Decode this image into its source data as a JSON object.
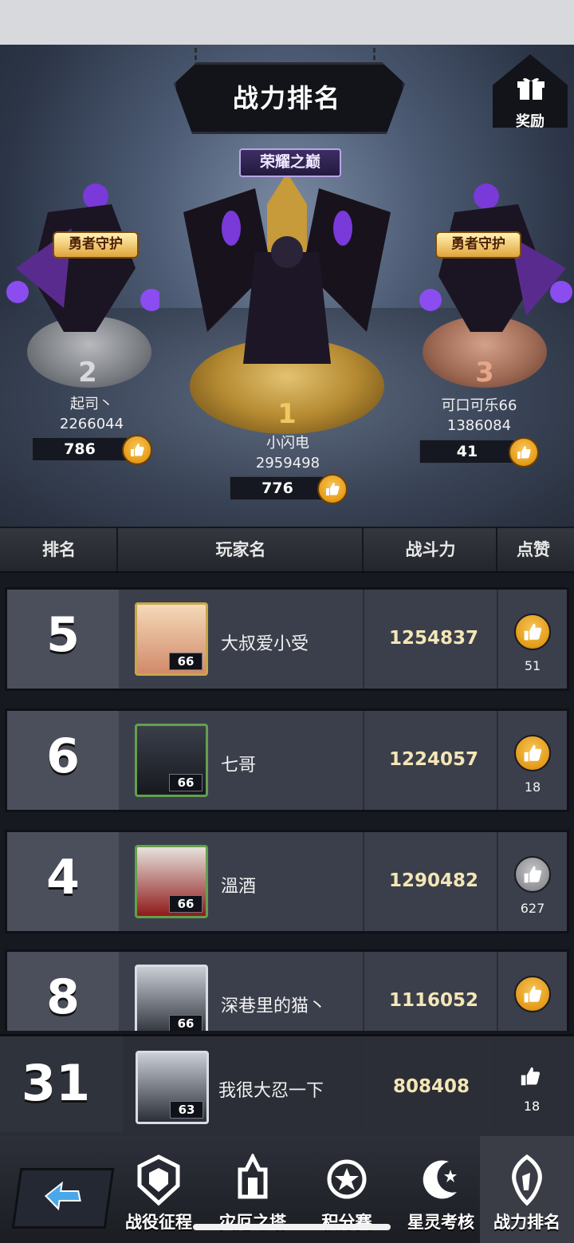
{
  "header": {
    "title": "战力排名",
    "reward_label": "奖励",
    "glory_label": "荣耀之巅",
    "guardian_label": "勇者守护"
  },
  "podium": [
    {
      "rank": "1",
      "name": "小闪电",
      "power": "2959498",
      "likes": "776"
    },
    {
      "rank": "2",
      "name": "起司丶",
      "power": "2266044",
      "likes": "786"
    },
    {
      "rank": "3",
      "name": "可口可乐66",
      "power": "1386084",
      "likes": "41"
    }
  ],
  "table": {
    "headers": [
      "排名",
      "玩家名",
      "战斗力",
      "点赞"
    ],
    "rows": [
      {
        "rank": "5",
        "name": "大叔爱小受",
        "power": "1254837",
        "likes": "51",
        "level": "66",
        "liked": false
      },
      {
        "rank": "6",
        "name": "七哥",
        "power": "1224057",
        "likes": "18",
        "level": "66",
        "liked": false
      },
      {
        "rank": "4",
        "name": "溫酒",
        "power": "1290482",
        "likes": "627",
        "level": "66",
        "liked": true
      },
      {
        "rank": "8",
        "name": "深巷里的猫丶",
        "power": "1116052",
        "likes": "",
        "level": "66",
        "liked": false
      }
    ]
  },
  "my_rank": {
    "rank": "31",
    "name": "我很大忍一下",
    "power": "808408",
    "likes": "18",
    "level": "63"
  },
  "nav": [
    {
      "label": "战役征程"
    },
    {
      "label": "灾厄之塔"
    },
    {
      "label": "积分赛"
    },
    {
      "label": "星灵考核"
    },
    {
      "label": "战力排名"
    }
  ],
  "colors": {
    "gold": "#e69b17",
    "power_text": "#f4e6b6",
    "bg": "#15171d"
  }
}
